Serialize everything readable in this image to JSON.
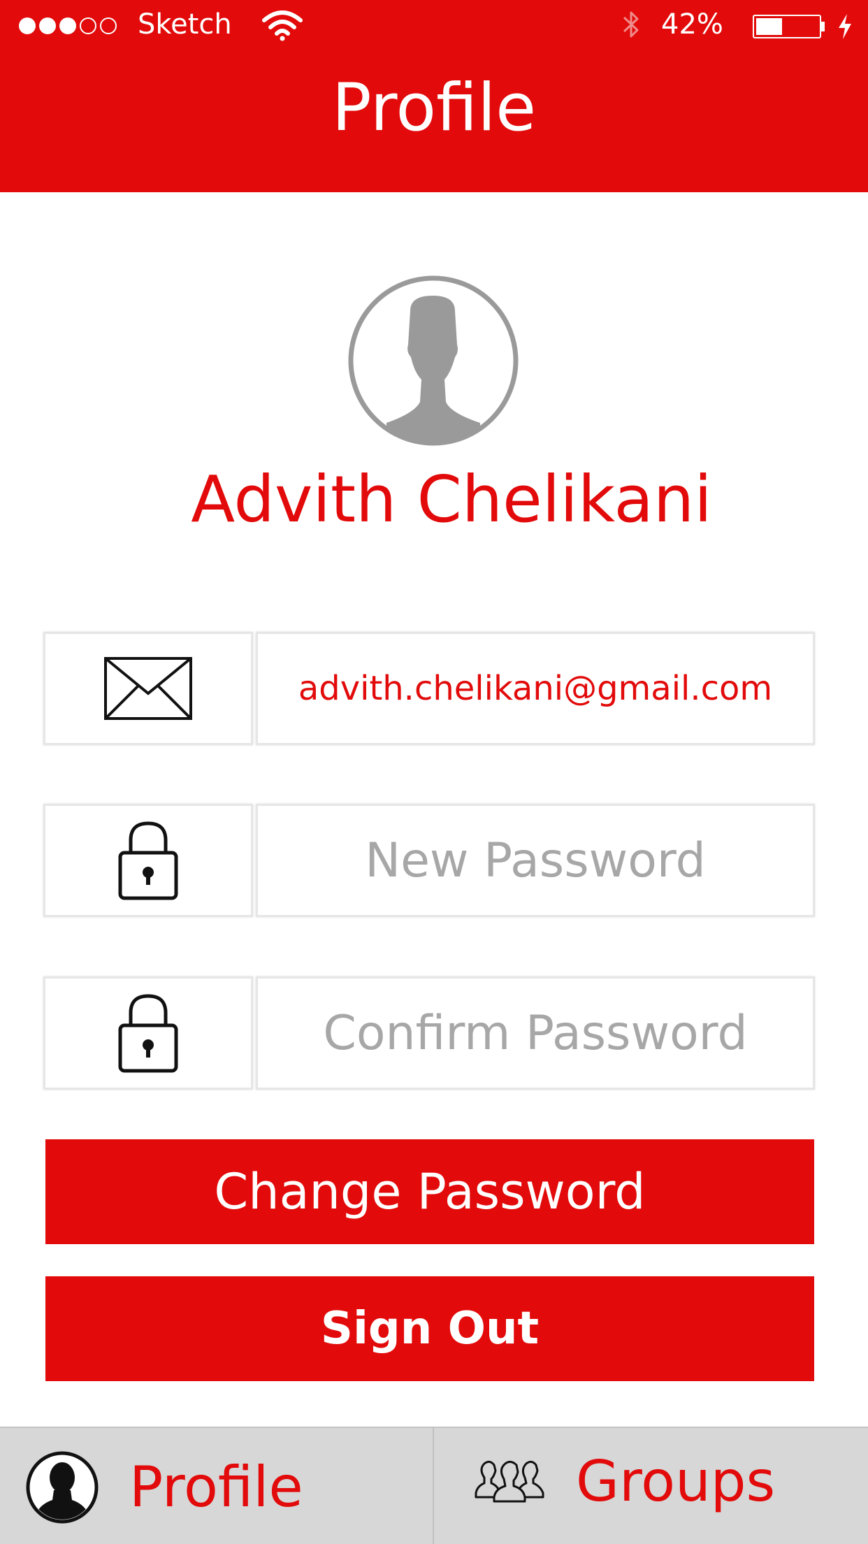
{
  "status_bar": {
    "signal_full": 3,
    "signal_total": 5,
    "carrier": "Sketch",
    "battery_percent": "42%",
    "battery_level": 0.42,
    "icons": [
      "wifi-icon",
      "bluetooth-icon",
      "battery-icon",
      "charging-bolt-icon"
    ]
  },
  "nav": {
    "title": "Profile"
  },
  "profile": {
    "name": "Advith Chelikani",
    "avatar_icon": "user-silhouette-icon"
  },
  "fields": {
    "email": {
      "value": "advith.chelikani@gmail.com",
      "icon": "envelope-icon"
    },
    "new_password": {
      "placeholder": "New Password",
      "icon": "lock-icon"
    },
    "confirm_password": {
      "placeholder": "Confirm Password",
      "icon": "lock-icon"
    }
  },
  "buttons": {
    "change_password": "Change Password",
    "sign_out": "Sign Out"
  },
  "tabbar": {
    "profile": {
      "label": "Profile",
      "icon": "person-icon"
    },
    "groups": {
      "label": "Groups",
      "icon": "group-icon"
    }
  },
  "colors": {
    "accent": "#e20a0a",
    "placeholder": "#a7a7a7",
    "tabbar_bg": "#d7d7d7"
  }
}
